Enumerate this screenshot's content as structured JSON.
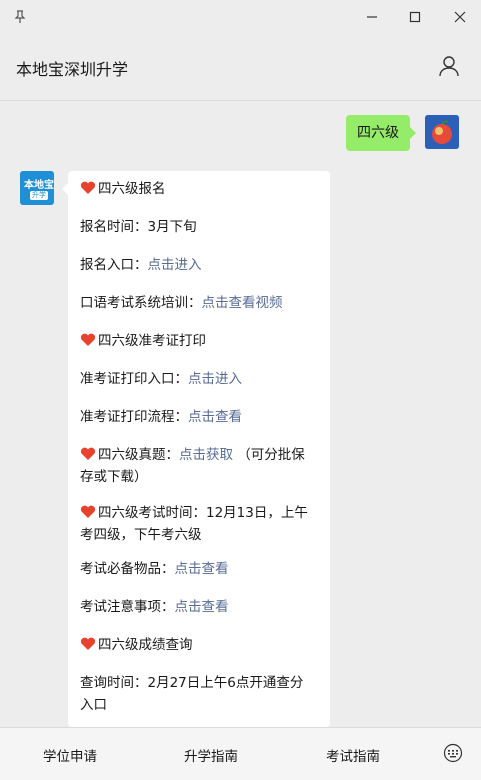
{
  "header": {
    "title": "本地宝深圳升学"
  },
  "user_message": {
    "text": "四六级"
  },
  "bot_avatar": {
    "line1": "本地宝",
    "line2": "升学"
  },
  "bot_message": {
    "section1_title": "四六级报名",
    "reg_time_label": "报名时间：",
    "reg_time_value": "3月下旬",
    "reg_entry_label": "报名入口：",
    "reg_entry_link": "点击进入",
    "oral_label": "口语考试系统培训：",
    "oral_link": "点击查看视频",
    "section2_title": "四六级准考证打印",
    "admit_entry_label": "准考证打印入口：",
    "admit_entry_link": "点击进入",
    "admit_flow_label": "准考证打印流程：",
    "admit_flow_link": "点击查看",
    "past_label": "四六级真题：",
    "past_link": "点击获取",
    "past_note_1": "（可分批保",
    "past_note_2": "存或下载）",
    "exam_time_1": "四六级考试时间：12月13日，上午",
    "exam_time_2": "考四级，下午考六级",
    "items_label": "考试必备物品：",
    "items_link": "点击查看",
    "notes_label": "考试注意事项：",
    "notes_link": "点击查看",
    "section3_title": "四六级成绩查询",
    "query_1": "查询时间：2月27日上午6点开通查分",
    "query_2": "入口"
  },
  "bottom_menu": [
    "学位申请",
    "升学指南",
    "考试指南"
  ],
  "colors": {
    "accent_link": "#576b95",
    "user_bubble": "#95ec69",
    "heart": "#e8412c"
  }
}
